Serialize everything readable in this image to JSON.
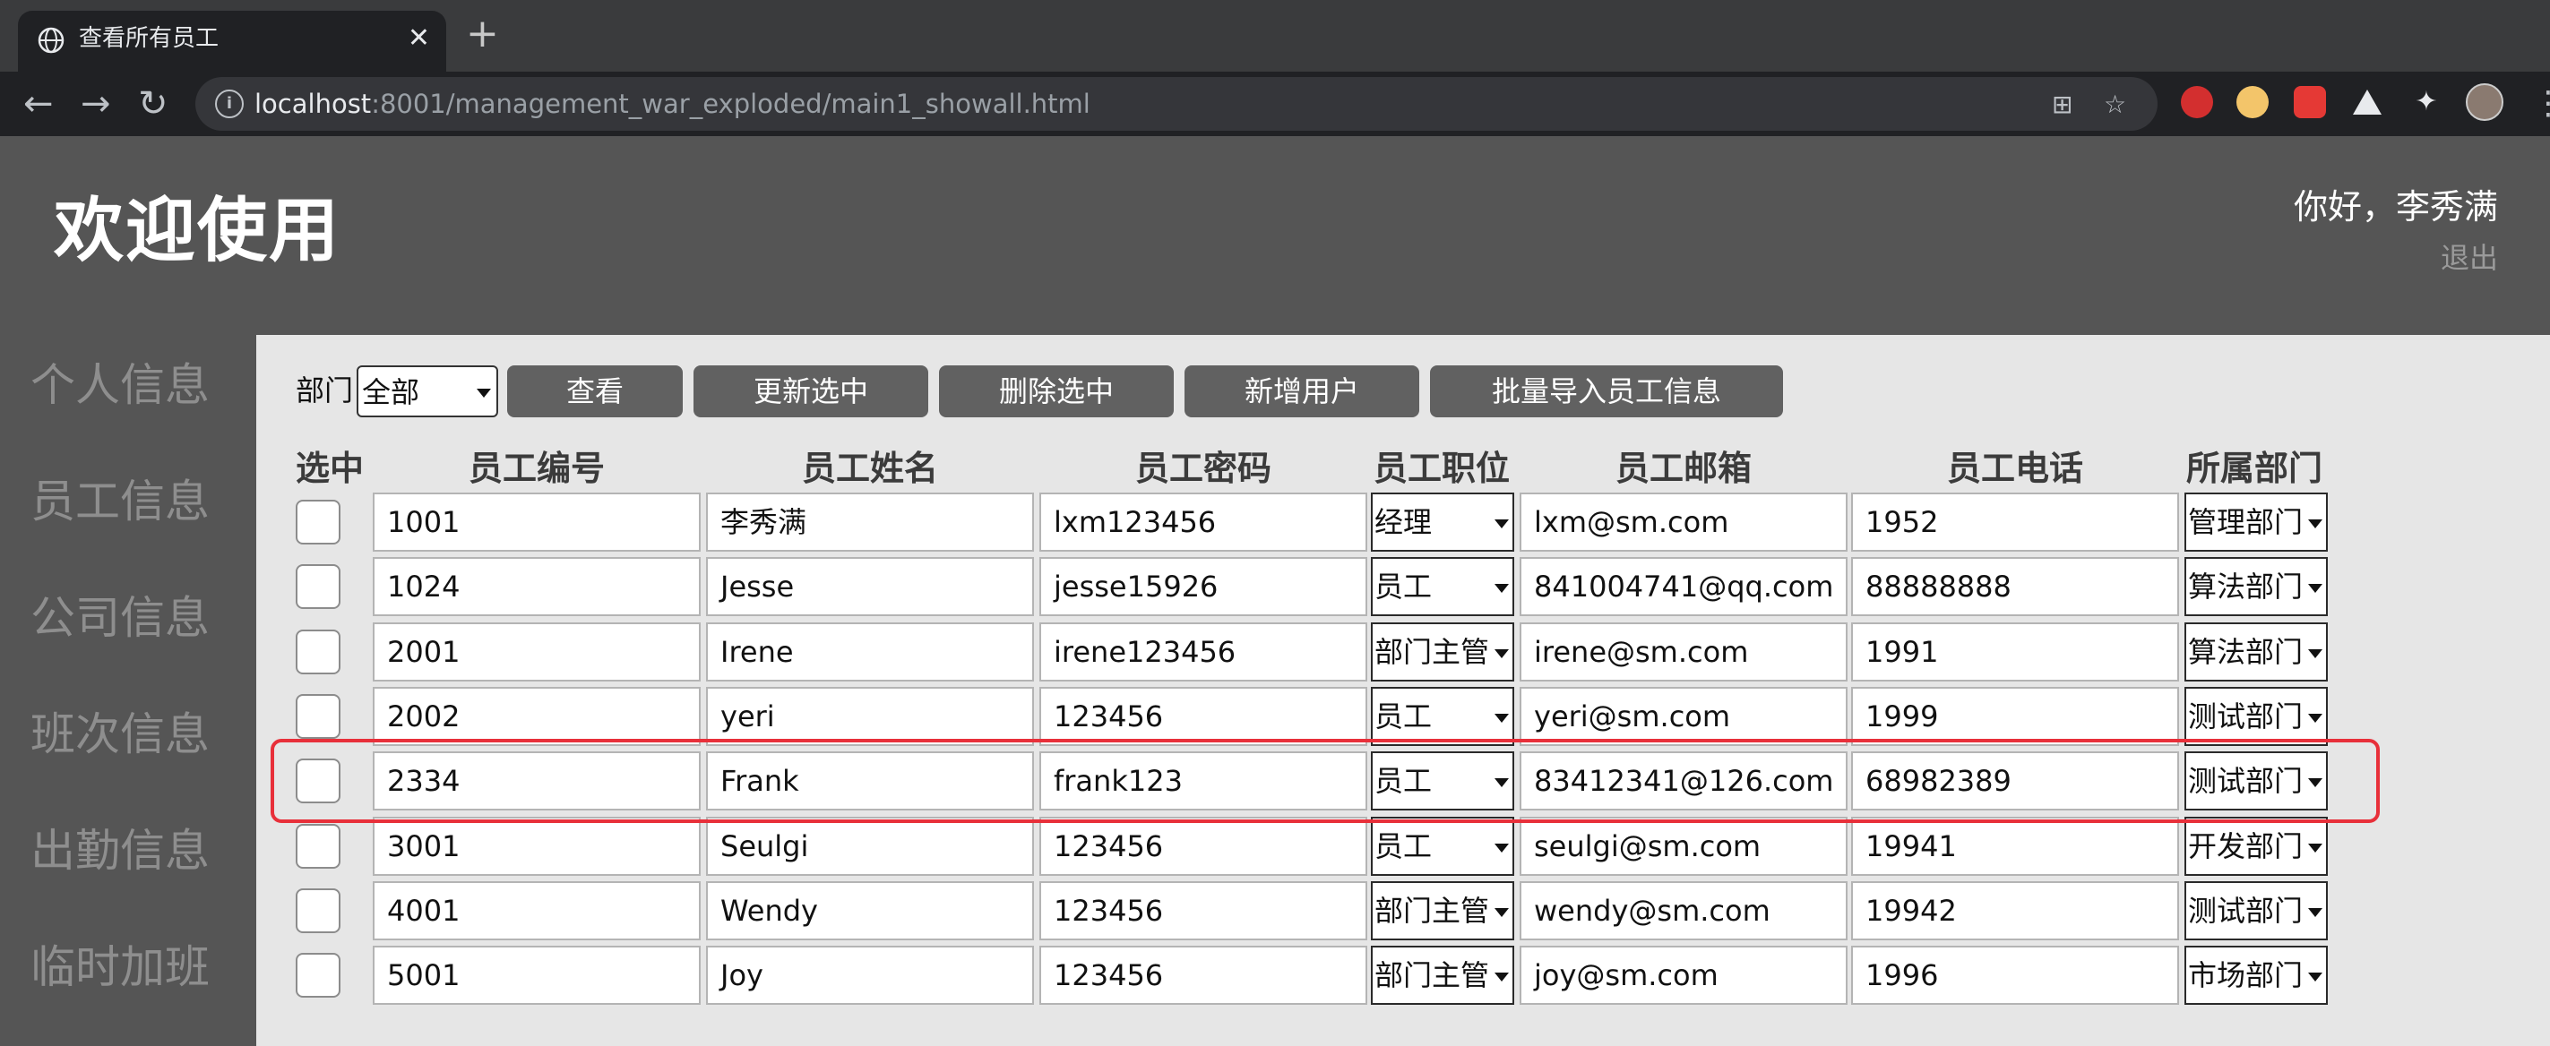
{
  "browser": {
    "tab_title": "查看所有员工",
    "url_host": "localhost",
    "url_rest": ":8001/management_war_exploded/main1_showall.html"
  },
  "header": {
    "title": "欢迎使用",
    "greeting": "你好，李秀满",
    "logout": "退出"
  },
  "sidebar": {
    "items": [
      "个人信息",
      "员工信息",
      "公司信息",
      "班次信息",
      "出勤信息",
      "临时加班"
    ]
  },
  "toolbar": {
    "dept_label": "部门",
    "dept_value": "全部",
    "buttons": [
      "查看",
      "更新选中",
      "删除选中",
      "新增用户",
      "批量导入员工信息"
    ]
  },
  "table": {
    "headers": [
      "选中",
      "员工编号",
      "员工姓名",
      "员工密码",
      "员工职位",
      "员工邮箱",
      "员工电话",
      "所属部门"
    ],
    "rows": [
      {
        "id": "1001",
        "name": "李秀满",
        "password": "lxm123456",
        "position": "经理",
        "email": "lxm@sm.com",
        "phone": "1952",
        "dept": "管理部门"
      },
      {
        "id": "1024",
        "name": "Jesse",
        "password": "jesse15926",
        "position": "员工",
        "email": "841004741@qq.com",
        "phone": "88888888",
        "dept": "算法部门"
      },
      {
        "id": "2001",
        "name": "Irene",
        "password": "irene123456",
        "position": "部门主管",
        "email": "irene@sm.com",
        "phone": "1991",
        "dept": "算法部门"
      },
      {
        "id": "2002",
        "name": "yeri",
        "password": "123456",
        "position": "员工",
        "email": "yeri@sm.com",
        "phone": "1999",
        "dept": "测试部门"
      },
      {
        "id": "2334",
        "name": "Frank",
        "password": "frank123",
        "position": "员工",
        "email": "83412341@126.com",
        "phone": "68982389",
        "dept": "测试部门"
      },
      {
        "id": "3001",
        "name": "Seulgi",
        "password": "123456",
        "position": "员工",
        "email": "seulgi@sm.com",
        "phone": "19941",
        "dept": "开发部门"
      },
      {
        "id": "4001",
        "name": "Wendy",
        "password": "123456",
        "position": "部门主管",
        "email": "wendy@sm.com",
        "phone": "19942",
        "dept": "测试部门"
      },
      {
        "id": "5001",
        "name": "Joy",
        "password": "123456",
        "position": "部门主管",
        "email": "joy@sm.com",
        "phone": "1996",
        "dept": "市场部门"
      }
    ],
    "highlighted_row_index": 4,
    "highlight_color": "#e8303a"
  }
}
